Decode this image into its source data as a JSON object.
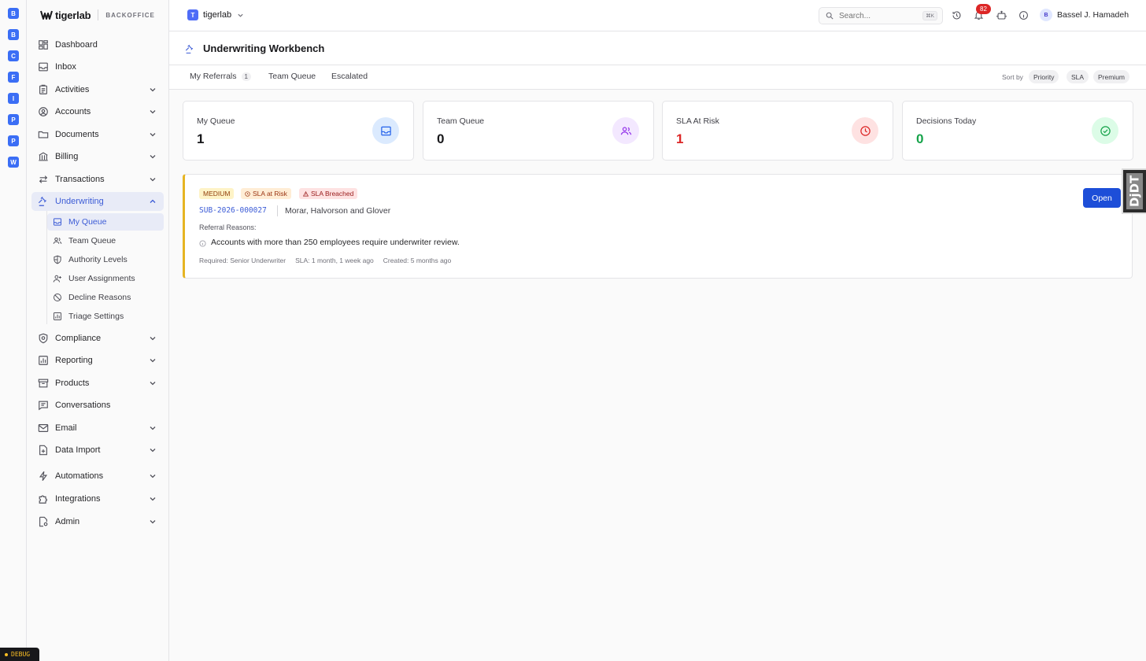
{
  "rail": {
    "items": [
      "B",
      "B",
      "C",
      "F",
      "I",
      "P",
      "P",
      "W"
    ]
  },
  "brand": {
    "name": "tigerlab",
    "subtitle": "BACKOFFICE"
  },
  "sidebar": {
    "dashboard": "Dashboard",
    "inbox": "Inbox",
    "activities": "Activities",
    "accounts": "Accounts",
    "documents": "Documents",
    "billing": "Billing",
    "transactions": "Transactions",
    "underwriting": "Underwriting",
    "underwriting_sub": {
      "my_queue": "My Queue",
      "team_queue": "Team Queue",
      "authority_levels": "Authority Levels",
      "user_assignments": "User Assignments",
      "decline_reasons": "Decline Reasons",
      "triage_settings": "Triage Settings"
    },
    "compliance": "Compliance",
    "reporting": "Reporting",
    "products": "Products",
    "conversations": "Conversations",
    "email": "Email",
    "data_import": "Data Import",
    "automations": "Automations",
    "integrations": "Integrations",
    "admin": "Admin"
  },
  "debug_label": "DEBUG",
  "topbar": {
    "tenant_initial": "T",
    "tenant_name": "tigerlab",
    "search_placeholder": "Search...",
    "search_shortcut": "⌘K",
    "notification_count": "82",
    "user_initial": "B",
    "user_name": "Bassel J. Hamadeh"
  },
  "page": {
    "title": "Underwriting Workbench"
  },
  "tabs": {
    "my_referrals": "My Referrals",
    "my_referrals_count": "1",
    "team_queue": "Team Queue",
    "escalated": "Escalated",
    "sort_label": "Sort by",
    "sort_options": [
      "Priority",
      "SLA",
      "Premium"
    ]
  },
  "stats": {
    "my_queue": {
      "label": "My Queue",
      "value": "1"
    },
    "team_queue": {
      "label": "Team Queue",
      "value": "0"
    },
    "sla_at_risk": {
      "label": "SLA At Risk",
      "value": "1"
    },
    "decisions_today": {
      "label": "Decisions Today",
      "value": "0"
    }
  },
  "referral": {
    "priority": "MEDIUM",
    "sla_at_risk": "SLA at Risk",
    "sla_breached": "SLA Breached",
    "id": "SUB-2026-000027",
    "account": "Morar, Halvorson and Glover",
    "reasons_label": "Referral Reasons:",
    "reason": "Accounts with more than 250 employees require underwriter review.",
    "required": "Required: Senior Underwriter",
    "sla": "SLA: 1 month, 1 week ago",
    "created": "Created: 5 months ago",
    "open_label": "Open"
  },
  "djdt_label": "DjDT",
  "colors": {
    "accent": "#3b5bd6",
    "primary_button": "#1d4ed8",
    "danger": "#dc2626",
    "success": "#16a34a",
    "warning_border": "#e6b422"
  }
}
